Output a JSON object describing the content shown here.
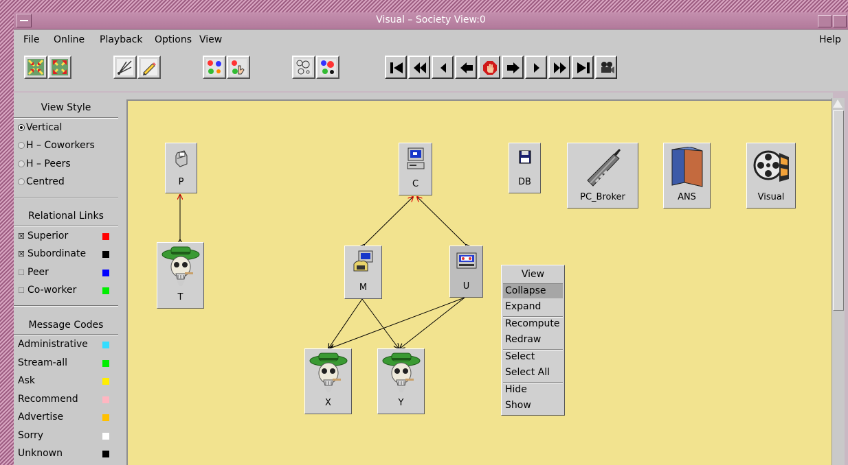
{
  "window": {
    "title": "Visual – Society View:0"
  },
  "menu": {
    "file": "File",
    "online": "Online",
    "playback": "Playback",
    "options": "Options",
    "view": "View",
    "help": "Help"
  },
  "sidebar": {
    "view_style": {
      "title": "View Style",
      "options": [
        {
          "label": "Vertical",
          "selected": true
        },
        {
          "label": "H – Coworkers",
          "selected": false
        },
        {
          "label": "H – Peers",
          "selected": false
        },
        {
          "label": "Centred",
          "selected": false
        }
      ]
    },
    "relational_links": {
      "title": "Relational Links",
      "items": [
        {
          "label": "Superior",
          "checked": true,
          "color": "#ff0000"
        },
        {
          "label": "Subordinate",
          "checked": true,
          "color": "#000000"
        },
        {
          "label": "Peer",
          "checked": false,
          "color": "#0000ff"
        },
        {
          "label": "Co-worker",
          "checked": false,
          "color": "#00ee00"
        }
      ]
    },
    "message_codes": {
      "title": "Message Codes",
      "items": [
        {
          "label": "Administrative",
          "color": "#33ddff"
        },
        {
          "label": "Stream-all",
          "color": "#00ee00"
        },
        {
          "label": "Ask",
          "color": "#ffee00"
        },
        {
          "label": "Recommend",
          "color": "#ffb6c1"
        },
        {
          "label": "Advertise",
          "color": "#ffc000"
        },
        {
          "label": "Sorry",
          "color": "#ffffff"
        },
        {
          "label": "Unknown",
          "color": "#000000"
        }
      ]
    }
  },
  "nodes": {
    "p": "P",
    "t": "T",
    "c": "C",
    "m": "M",
    "u": "U",
    "x": "X",
    "y": "Y",
    "db": "DB",
    "pc_broker": "PC_Broker",
    "ans": "ANS",
    "visual": "Visual"
  },
  "context_menu": {
    "title": "View",
    "items": [
      "Collapse",
      "Expand",
      "Recompute",
      "Redraw",
      "Select",
      "Select All",
      "Hide",
      "Show"
    ],
    "highlighted": "Collapse"
  },
  "icons": {
    "toolbar": [
      "collapse-icon",
      "expand-icon",
      "draw-links-icon",
      "edit-pencil-icon",
      "agents-colored-icon",
      "agents-hand-icon",
      "bubbles-empty-icon",
      "bubbles-colored-icon"
    ],
    "playback": [
      "first-frame-icon",
      "rewind-icon",
      "step-back-icon",
      "back-arrow-icon",
      "stop-hand-icon",
      "forward-arrow-icon",
      "play-icon",
      "fast-forward-icon",
      "last-frame-icon",
      "camera-icon"
    ]
  }
}
